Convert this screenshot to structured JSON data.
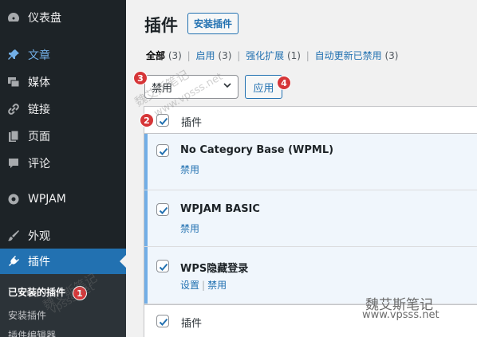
{
  "sidebar": {
    "items": [
      {
        "label": "仪表盘",
        "icon": "dashboard-icon"
      },
      {
        "label": "文章",
        "icon": "pin-icon"
      },
      {
        "label": "媒体",
        "icon": "media-icon"
      },
      {
        "label": "链接",
        "icon": "link-icon"
      },
      {
        "label": "页面",
        "icon": "page-icon"
      },
      {
        "label": "评论",
        "icon": "comment-icon"
      },
      {
        "label": "WPJAM",
        "icon": "wpjam-icon"
      },
      {
        "label": "外观",
        "icon": "brush-icon"
      },
      {
        "label": "插件",
        "icon": "plugin-icon"
      }
    ],
    "submenu": [
      "已安装的插件",
      "安装插件",
      "插件编辑器"
    ]
  },
  "header": {
    "title": "插件",
    "add_new": "安装插件"
  },
  "filters": [
    {
      "label": "全部",
      "count": "(3)"
    },
    {
      "label": "启用",
      "count": "(3)"
    },
    {
      "label": "强化扩展",
      "count": "(1)"
    },
    {
      "label": "自动更新已禁用",
      "count": "(3)"
    }
  ],
  "bulk": {
    "selected": "禁用",
    "apply": "应用"
  },
  "table": {
    "column": "插件",
    "plugins": [
      {
        "name": "No Category Base (WPML)",
        "actions": [
          "禁用"
        ]
      },
      {
        "name": "WPJAM BASIC",
        "actions": [
          "禁用"
        ]
      },
      {
        "name": "WPS隐藏登录",
        "actions": [
          "设置",
          "禁用"
        ]
      }
    ]
  },
  "badges": [
    "1",
    "2",
    "3",
    "4"
  ],
  "watermark": {
    "site": "vpsss.net",
    "site_full": "www.vpsss.net",
    "name": "魏艾斯笔记"
  },
  "colors": {
    "sidebar": "#1d2327",
    "accent": "#2271b1",
    "active_row": "#f0f6fc",
    "badge": "#d63638"
  }
}
